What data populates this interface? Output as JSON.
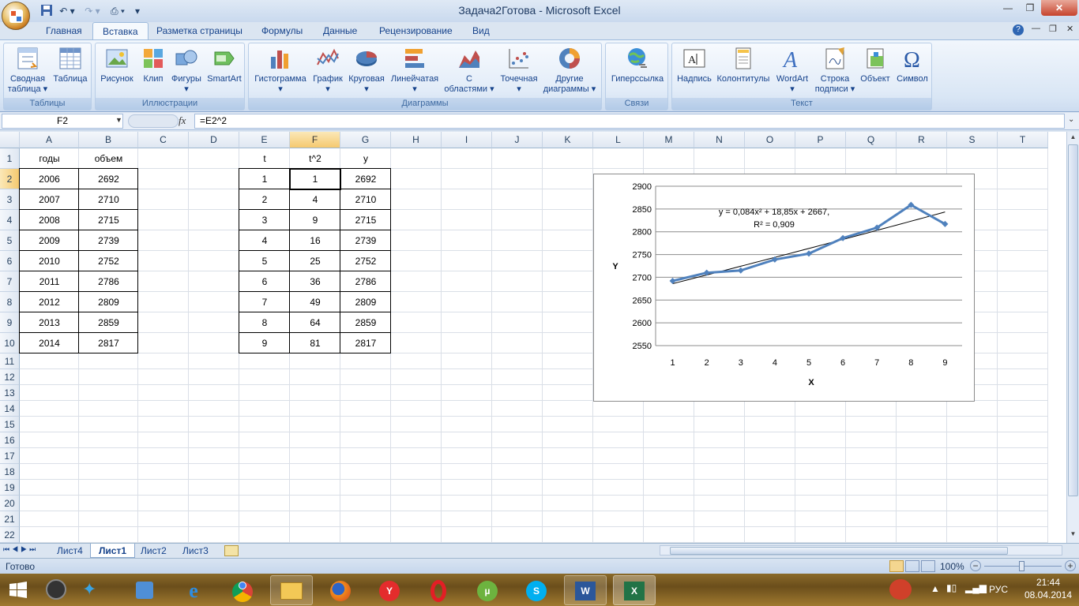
{
  "window": {
    "title": "Задача2Готова - Microsoft Excel"
  },
  "tabs": [
    "Главная",
    "Вставка",
    "Разметка страницы",
    "Формулы",
    "Данные",
    "Рецензирование",
    "Вид"
  ],
  "active_tab": "Вставка",
  "ribbon": {
    "groups": [
      {
        "label": "Таблицы",
        "buttons": [
          "Сводная таблица",
          "Таблица"
        ]
      },
      {
        "label": "Иллюстрации",
        "buttons": [
          "Рисунок",
          "Клип",
          "Фигуры",
          "SmartArt"
        ]
      },
      {
        "label": "Диаграммы",
        "buttons": [
          "Гистограмма",
          "График",
          "Круговая",
          "Линейчатая",
          "С областями",
          "Точечная",
          "Другие диаграммы"
        ]
      },
      {
        "label": "Связи",
        "buttons": [
          "Гиперссылка"
        ]
      },
      {
        "label": "Текст",
        "buttons": [
          "Надпись",
          "Колонтитулы",
          "WordArt",
          "Строка подписи",
          "Объект",
          "Символ"
        ]
      }
    ],
    "sv1": "Сводная",
    "sv2": "таблица",
    "oa1": "С",
    "oa2": "областями",
    "dd1": "Другие",
    "dd2": "диаграммы",
    "sp1": "Строка",
    "sp2": "подписи"
  },
  "formula_bar": {
    "name_box": "F2",
    "fx": "fx",
    "formula": "=E2^2"
  },
  "columns": [
    "A",
    "B",
    "C",
    "D",
    "E",
    "F",
    "G",
    "H",
    "I",
    "J",
    "K",
    "L",
    "M",
    "N",
    "O",
    "P",
    "Q",
    "R",
    "S",
    "T"
  ],
  "rows": [
    "1",
    "2",
    "3",
    "4",
    "5",
    "6",
    "7",
    "8",
    "9",
    "10",
    "11",
    "12",
    "13",
    "14",
    "15",
    "16",
    "17",
    "18",
    "19",
    "20",
    "21",
    "22"
  ],
  "table1": {
    "headers": [
      "годы",
      "объем"
    ],
    "rows": [
      [
        "2006",
        "2692"
      ],
      [
        "2007",
        "2710"
      ],
      [
        "2008",
        "2715"
      ],
      [
        "2009",
        "2739"
      ],
      [
        "2010",
        "2752"
      ],
      [
        "2011",
        "2786"
      ],
      [
        "2012",
        "2809"
      ],
      [
        "2013",
        "2859"
      ],
      [
        "2014",
        "2817"
      ]
    ]
  },
  "table2": {
    "headers": [
      "t",
      "t^2",
      "y"
    ],
    "rows": [
      [
        "1",
        "1",
        "2692"
      ],
      [
        "2",
        "4",
        "2710"
      ],
      [
        "3",
        "9",
        "2715"
      ],
      [
        "4",
        "16",
        "2739"
      ],
      [
        "5",
        "25",
        "2752"
      ],
      [
        "6",
        "36",
        "2786"
      ],
      [
        "7",
        "49",
        "2809"
      ],
      [
        "8",
        "64",
        "2859"
      ],
      [
        "9",
        "81",
        "2817"
      ]
    ]
  },
  "chart_data": {
    "type": "line",
    "x": [
      1,
      2,
      3,
      4,
      5,
      6,
      7,
      8,
      9
    ],
    "series": [
      {
        "values": [
          2692,
          2710,
          2715,
          2739,
          2752,
          2786,
          2809,
          2859,
          2817
        ],
        "color": "#4f81bd"
      }
    ],
    "trendline": {
      "type": "polynomial-2",
      "coefficients": [
        0.084,
        18.85,
        2667
      ],
      "color": "#000000"
    },
    "equation_line1": "y = 0,084x² + 18,85x + 2667,",
    "equation_line2": "R² = 0,909",
    "title": "",
    "xlabel": "X",
    "ylabel": "Y",
    "ylim": [
      2550,
      2900
    ],
    "yticks": [
      2550,
      2600,
      2650,
      2700,
      2750,
      2800,
      2850,
      2900
    ],
    "xticks": [
      "1",
      "2",
      "3",
      "4",
      "5",
      "6",
      "7",
      "8",
      "9"
    ],
    "grid": true,
    "legend": "none"
  },
  "sheet_tabs": [
    "Лист4",
    "Лист1",
    "Лист2",
    "Лист3"
  ],
  "active_sheet": "Лист1",
  "status": {
    "ready": "Готово",
    "zoom": "100%"
  },
  "taskbar": {
    "lang": "РУС",
    "time": "21:44",
    "date": "08.04.2014"
  }
}
